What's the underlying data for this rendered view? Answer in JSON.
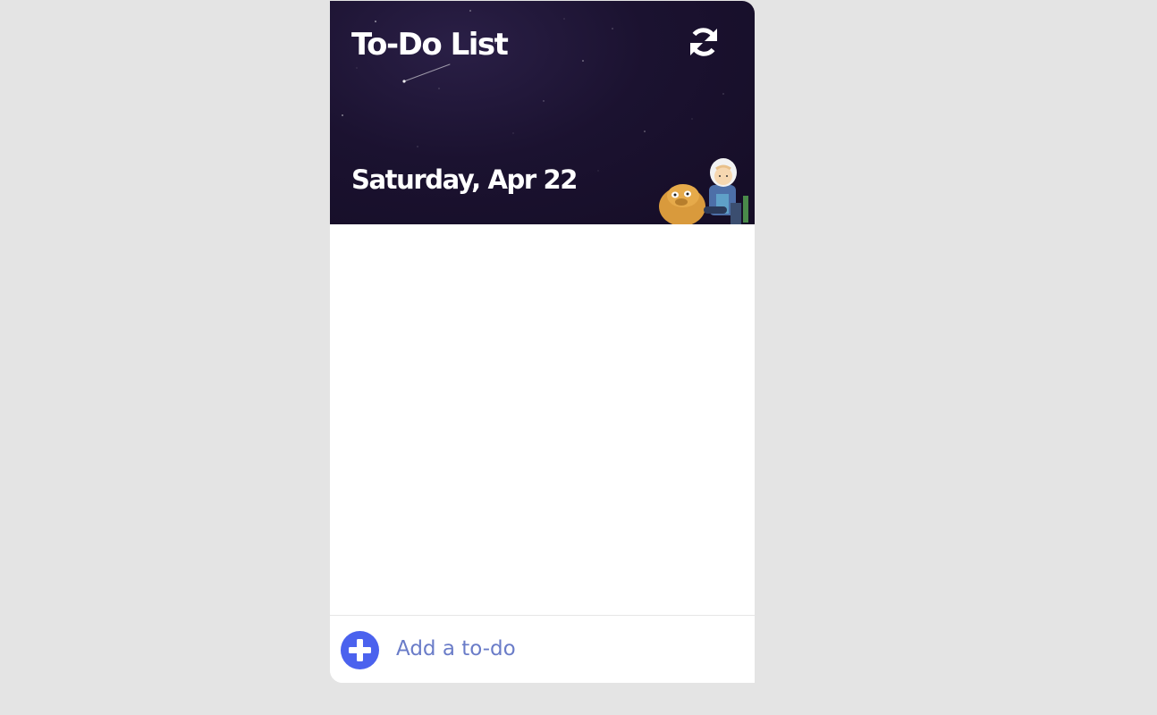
{
  "header": {
    "title": "To-Do List",
    "date": "Saturday, Apr 22",
    "refresh_icon": "refresh-icon"
  },
  "todos": [],
  "footer": {
    "add_icon": "plus-circle-icon",
    "input_placeholder": "Add a to-do",
    "input_value": ""
  },
  "colors": {
    "page_background": "#e4e4e4",
    "header_background": "#1b1230",
    "accent": "#4b62ee",
    "placeholder_text": "#6a7cc8"
  }
}
